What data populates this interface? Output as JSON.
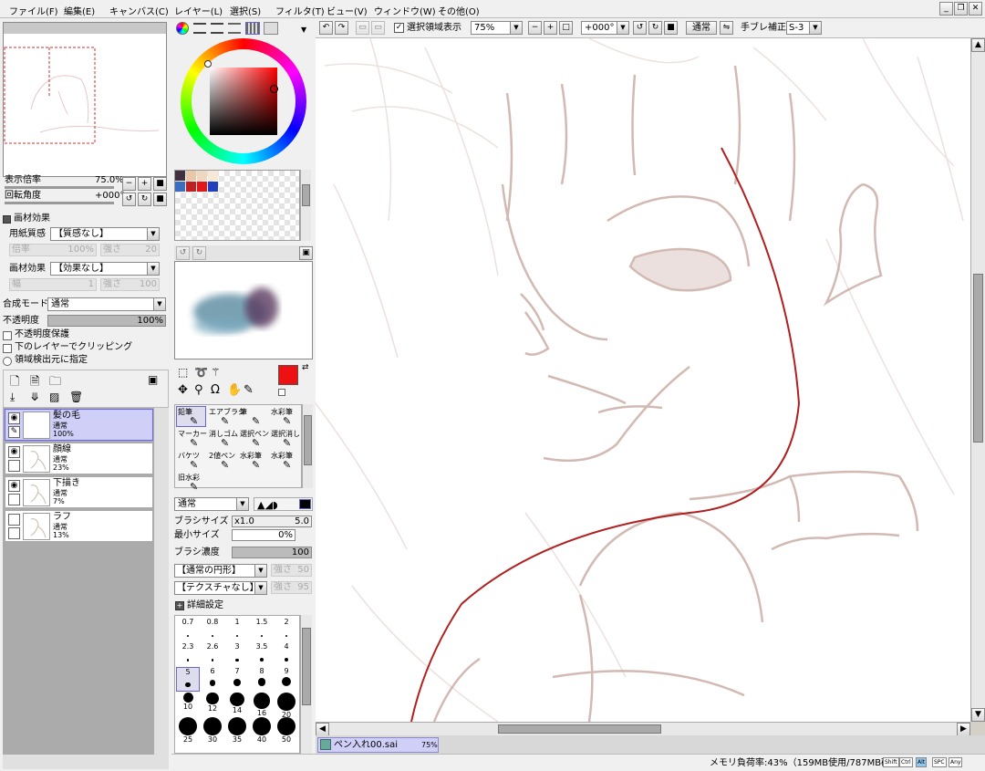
{
  "menu": [
    "ファイル(F)",
    "編集(E)",
    "キャンバス(C)",
    "レイヤー(L)",
    "選択(S)",
    "フィルタ(T)",
    "ビュー(V)",
    "ウィンドウ(W)",
    "その他(O)"
  ],
  "window_controls": [
    "_",
    "❐",
    "✕"
  ],
  "navigator": {
    "zoom_label": "表示倍率",
    "zoom_value": "75.0%",
    "rotate_label": "回転角度",
    "rotate_value": "+000°"
  },
  "material": {
    "header": "画材効果",
    "paper_label": "用紙質感",
    "paper_value": "【質感なし】",
    "paper_scale_label": "倍率",
    "paper_scale_value": "100%",
    "paper_strength_label": "強さ",
    "paper_strength_value": "20",
    "effect_label": "画材効果",
    "effect_value": "【効果なし】",
    "effect_width_label": "幅",
    "effect_width_value": "1",
    "effect_strength_label": "強さ",
    "effect_strength_value": "100"
  },
  "blend": {
    "mode_label": "合成モード",
    "mode_value": "通常",
    "opacity_label": "不透明度",
    "opacity_value": "100%",
    "opacity_fraction": 1.0,
    "protect_alpha": "不透明度保護",
    "clip_below": "下のレイヤーでクリッピング",
    "selection_source": "領域検出元に指定"
  },
  "layers": [
    {
      "name": "髪の毛",
      "mode": "通常",
      "opacity": "100%",
      "selected": true,
      "visible": true,
      "thumb": "white"
    },
    {
      "name": "顔線",
      "mode": "通常",
      "opacity": "23%",
      "selected": false,
      "visible": true,
      "thumb": "sketch"
    },
    {
      "name": "下描き",
      "mode": "通常",
      "opacity": "7%",
      "selected": false,
      "visible": true,
      "thumb": "sketch"
    },
    {
      "name": "ラフ",
      "mode": "通常",
      "opacity": "13%",
      "selected": false,
      "visible": false,
      "thumb": "sketch"
    }
  ],
  "colors": {
    "primary": "#ee1111",
    "secondary": "#ffffff",
    "swatches": [
      "#403040",
      "#e8c8a8",
      "#f0d8c0",
      "#f8e8d8",
      "#3a6ec0",
      "#c02020",
      "#e01818",
      "#2040c0"
    ],
    "accent_selection": "#cfcff8",
    "stroke": "#b02020",
    "lineart": "#c8a8a0"
  },
  "tools": [
    {
      "label": "鉛筆",
      "selected": true
    },
    {
      "label": "エアブラシ",
      "selected": false
    },
    {
      "label": "筆",
      "selected": false
    },
    {
      "label": "水彩筆",
      "selected": false
    },
    {
      "label": "マーカー",
      "selected": false
    },
    {
      "label": "消しゴム",
      "selected": false
    },
    {
      "label": "選択ペン",
      "selected": false
    },
    {
      "label": "選択消し",
      "selected": false
    },
    {
      "label": "バケツ",
      "selected": false
    },
    {
      "label": "2値ペン",
      "selected": false
    },
    {
      "label": "水彩筆",
      "selected": false
    },
    {
      "label": "水彩筆",
      "selected": false
    },
    {
      "label": "旧水彩",
      "selected": false
    }
  ],
  "brush": {
    "mode_value": "通常",
    "size_label": "ブラシサイズ",
    "size_mult": "x1.0",
    "size_value": "5.0",
    "min_size_label": "最小サイズ",
    "min_size_value": "0%",
    "density_label": "ブラシ濃度",
    "density_value": "100",
    "shape_value": "【通常の円形】",
    "shape_strength_label": "強さ",
    "shape_strength_value": "50",
    "texture_value": "【テクスチャなし】",
    "texture_strength_label": "強さ",
    "texture_strength_value": "95",
    "details_label": "詳細設定"
  },
  "brush_sizes": [
    "0.7",
    "0.8",
    "1",
    "1.5",
    "2",
    "2.3",
    "2.6",
    "3",
    "3.5",
    "4",
    "5",
    "6",
    "7",
    "8",
    "9",
    "10",
    "12",
    "14",
    "16",
    "20",
    "25",
    "30",
    "35",
    "40",
    "50"
  ],
  "toolbar": {
    "selection_toggle": "選択領域表示",
    "zoom_value": "75%",
    "angle_value": "+000°",
    "mode_value": "通常",
    "stabilizer_label": "手ブレ補正",
    "stabilizer_value": "S-3"
  },
  "document_tab": {
    "name": "ペン入れ00.sai",
    "zoom": "75%"
  },
  "status": {
    "memory": "メモリ負荷率:43%（159MB使用/787MB確保）",
    "keys": [
      "Shift",
      "Ctrl",
      "Alt",
      "SPC",
      "Any"
    ]
  },
  "icons": [
    "new-file-icon",
    "open-file-icon",
    "folder-icon",
    "new-layer-icon",
    "delete-icon",
    "eye-icon",
    "pen-icon",
    "move-icon",
    "zoom-icon",
    "rotate-icon",
    "hand-icon",
    "eyedropper-icon",
    "rect-select-icon",
    "lasso-icon",
    "magic-wand-icon"
  ]
}
